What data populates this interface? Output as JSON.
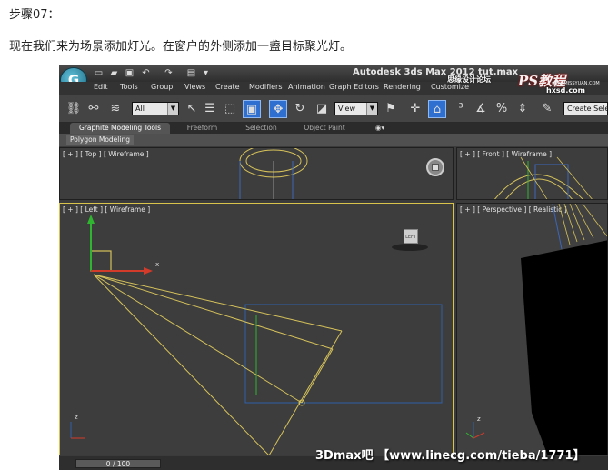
{
  "article": {
    "step_title": "步骤07：",
    "instruction": "现在我们来为场景添加灯光。在窗户的外侧添加一盏目标聚光灯。"
  },
  "app": {
    "window_title": "Autodesk 3ds Max  2012      tut.max",
    "logo_glyph": "G",
    "menu": [
      "Edit",
      "Tools",
      "Group",
      "Views",
      "Create",
      "Modifiers",
      "Animation",
      "Graph Editors",
      "Rendering",
      "Customize"
    ],
    "toolbar": {
      "selection_filter": "All",
      "ref_coord": "View",
      "search_placeholder": "Create Selection"
    },
    "ribbon_tabs": [
      "Graphite Modeling Tools",
      "Freeform",
      "Selection",
      "Object Paint"
    ],
    "ribbon_subtab": "Polygon Modeling",
    "viewports": {
      "top": "[ + ] [ Top ] [ Wireframe ]",
      "front": "[ + ] [ Front ] [ Wireframe ]",
      "left": "[ + ] [ Left ] [ Wireframe ]",
      "perspective": "[ + ] [ Perspective ] [ Realistic ]"
    },
    "left_viewcube": "LEFT",
    "axis_x": "x",
    "axis_z": "z",
    "timeline": "0 / 100"
  },
  "watermarks": {
    "forum": "思缘设计论坛",
    "forum_url": "www.MISSYUAN.COM",
    "site_logo": "PS教程",
    "site_url": "hxsd.com",
    "bottom": "3Dmax吧 【www.linecg.com/tieba/1771】"
  },
  "colors": {
    "accent_blue": "#2f6fd0",
    "light_cone": "#c8b44a",
    "gizmo_y": "#2fb52f",
    "gizmo_x": "#d23a2a",
    "window_frame": "#2e5fa8"
  }
}
